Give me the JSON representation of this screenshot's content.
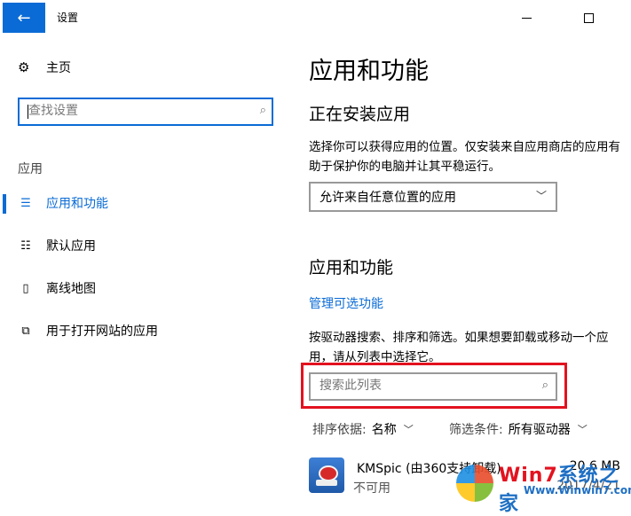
{
  "window": {
    "title": "设置",
    "back_icon": "←"
  },
  "sidebar": {
    "home_label": "主页",
    "search_placeholder": "查找设置",
    "section_label": "应用",
    "items": [
      {
        "label": "应用和功能",
        "icon": "apps-list-icon",
        "active": true
      },
      {
        "label": "默认应用",
        "icon": "default-apps-icon",
        "active": false
      },
      {
        "label": "离线地图",
        "icon": "map-icon",
        "active": false
      },
      {
        "label": "用于打开网站的应用",
        "icon": "open-website-icon",
        "active": false
      }
    ]
  },
  "main": {
    "title": "应用和功能",
    "install_heading": "正在安装应用",
    "install_desc": "选择你可以获得应用的位置。仅安装来自应用商店的应用有助于保护你的电脑并让其平稳运行。",
    "install_select_value": "允许来自任意位置的应用",
    "apps_heading": "应用和功能",
    "manage_link": "管理可选功能",
    "apps_desc": "按驱动器搜索、排序和筛选。如果想要卸载或移动一个应用，请从列表中选择它。",
    "list_search_placeholder": "搜索此列表",
    "sort_key": "排序依据:",
    "sort_value": "名称",
    "filter_key": "筛选条件:",
    "filter_value": "所有驱动器",
    "apps": [
      {
        "name": "KMSpic (由360支持卸载)",
        "status": "不可用",
        "size": "20.6 MB",
        "date": "2017/4/21"
      }
    ]
  },
  "watermark": {
    "title_a": "Win7",
    "title_b": "系统之家",
    "url": "Www.Winwin7.com"
  },
  "colors": {
    "accent": "#0a6bd6",
    "highlight": "#e3121f"
  }
}
